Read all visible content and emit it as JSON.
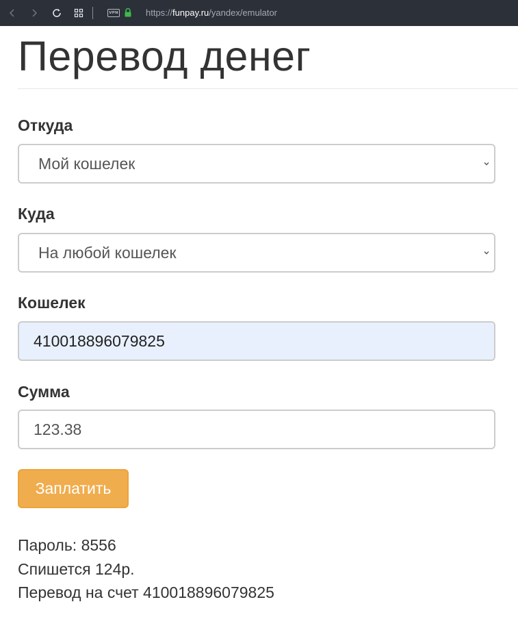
{
  "browser": {
    "url_scheme": "https://",
    "url_host": "funpay.ru",
    "url_path": "/yandex/emulator",
    "vpn_label": "VPN"
  },
  "page": {
    "title": "Перевод денег"
  },
  "form": {
    "from_label": "Откуда",
    "from_value": "Мой кошелек",
    "to_label": "Куда",
    "to_value": "На любой кошелек",
    "wallet_label": "Кошелек",
    "wallet_value": "410018896079825",
    "amount_label": "Сумма",
    "amount_value": "123.38",
    "submit_label": "Заплатить"
  },
  "info": {
    "password": "Пароль: 8556",
    "charge": "Спишется 124р.",
    "transfer": "Перевод на счет 410018896079825"
  },
  "colors": {
    "chrome_bg": "#2c3038",
    "button_bg": "#f0ad4e",
    "autofill_bg": "#e8f0fe",
    "lock_green": "#3dba4e"
  },
  "icons": [
    "back-icon",
    "forward-icon",
    "reload-icon",
    "tabs-grid-icon",
    "vpn-icon",
    "lock-icon",
    "chevron-down-icon"
  ]
}
